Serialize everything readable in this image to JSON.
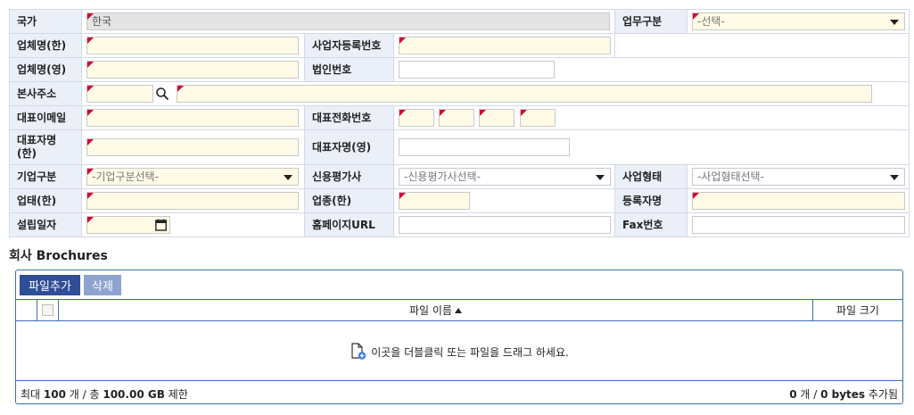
{
  "form": {
    "country_label": "국가",
    "country_value": "한국",
    "biz_type_label": "업무구분",
    "biz_type_placeholder": "-선택-",
    "company_name_kr_label": "업체명(한)",
    "biz_reg_no_label": "사업자등록번호",
    "company_name_en_label": "업체명(영)",
    "corp_no_label": "법인번호",
    "hq_address_label": "본사주소",
    "rep_email_label": "대표이메일",
    "rep_phone_label": "대표전화번호",
    "rep_name_kr_label": "대표자명(한)",
    "rep_name_en_label": "대표자명(영)",
    "company_class_label": "기업구분",
    "company_class_placeholder": "-기업구분선택-",
    "credit_agency_label": "신용평가사",
    "credit_agency_placeholder": "-신용평가사선택-",
    "business_form_label": "사업형태",
    "business_form_placeholder": "-사업형태선택-",
    "industry_label": "업태(한)",
    "category_label": "업종(한)",
    "registrant_label": "등록자명",
    "founded_label": "설립일자",
    "homepage_label": "홈페이지URL",
    "fax_label": "Fax번호"
  },
  "brochures": {
    "title": "회사 Brochures",
    "add_file_label": "파일추가",
    "delete_label": "삭제",
    "col_filename": "파일 이름",
    "col_filesize": "파일 크기",
    "drop_message": "이곳을 더블클릭 또는 파일을 드래그 하세요.",
    "footer_left_prefix": "최대 ",
    "max_count": "100",
    "footer_left_mid": " 개 / 총 ",
    "max_size": "100.00 GB",
    "footer_left_suffix": " 제한",
    "added_count": "0",
    "footer_right_mid": " 개 / ",
    "added_bytes": "0 bytes",
    "footer_right_suffix": " 추가됨"
  },
  "colors": {
    "label_bg": "#ebeff8",
    "required_bg": "#fffbe6",
    "required_mark": "#d60036",
    "primary_button": "#2f4e95",
    "disabled_button": "#8ea3cf",
    "border_blue": "#3f6cb5"
  },
  "icons": [
    "search-icon",
    "calendar-icon",
    "sort-asc-icon",
    "file-add-icon",
    "chevron-down-icon"
  ]
}
